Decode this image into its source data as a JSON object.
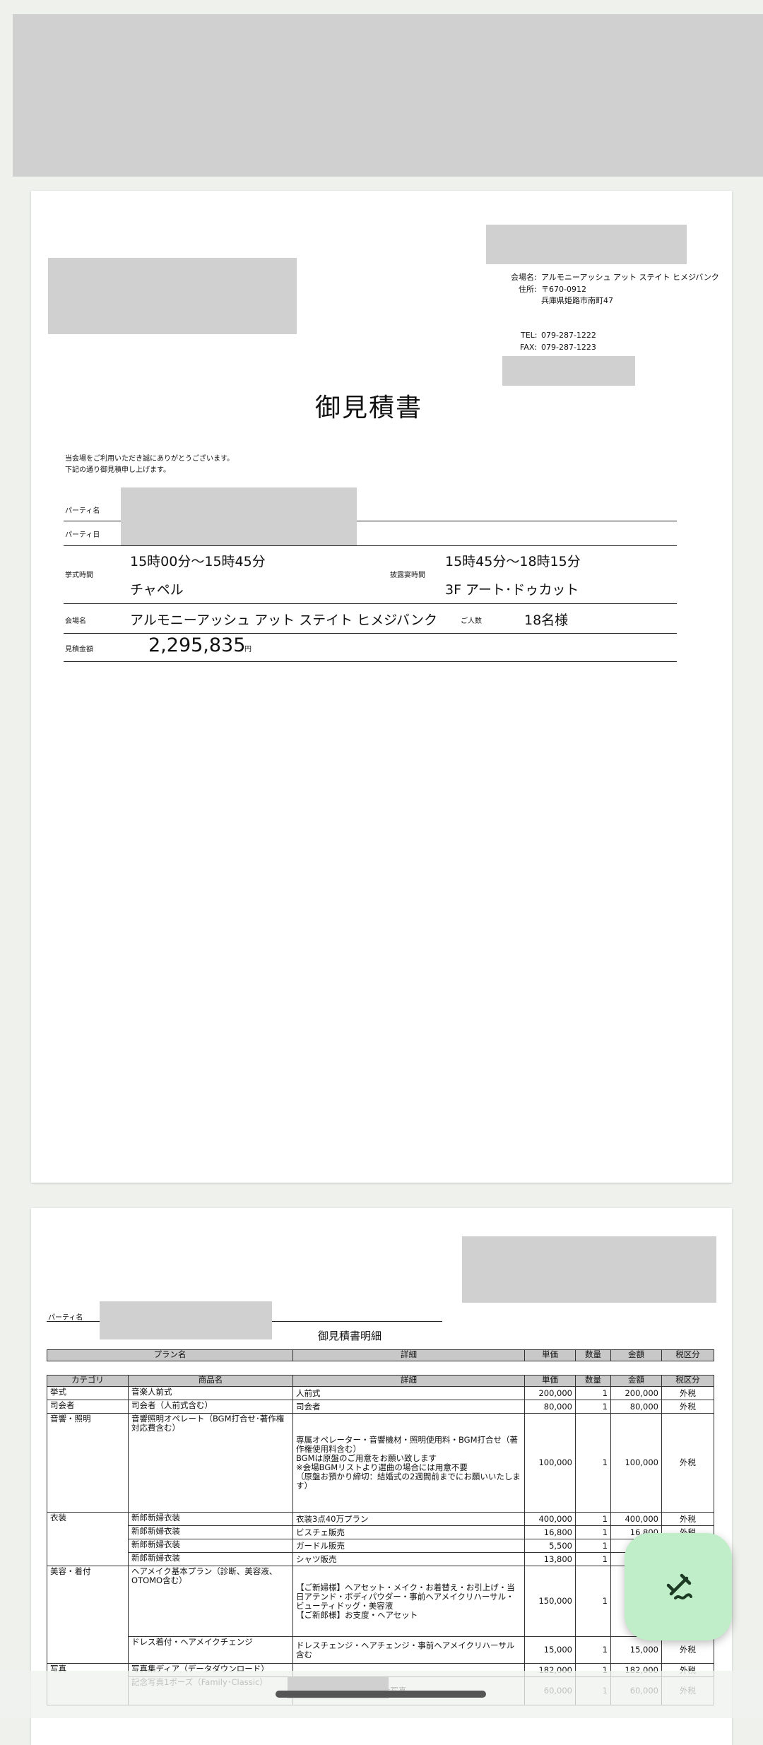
{
  "page1": {
    "venue_label": "会場名:",
    "venue_value": "アルモニーアッシュ アット ステイト ヒメジバンク",
    "address_label": "住所:",
    "postal": "〒670-0912",
    "address": "兵庫県姫路市南町47",
    "tel_label": "TEL:",
    "tel": "079-287-1222",
    "fax_label": "FAX:",
    "fax": "079-287-1223",
    "title": "御見積書",
    "greeting_line1": "当会場をご利用いただき誠にありがとうございます。",
    "greeting_line2": "下記の通り御見積申し上げます。",
    "party_name_label": "パーティ名",
    "party_date_label": "パーティ日",
    "ceremony_time_label": "挙式時間",
    "ceremony_time": "15時00分～15時45分",
    "ceremony_place": "チャペル",
    "reception_time_label": "披露宴時間",
    "reception_time": "15時45分～18時15分",
    "reception_place": "3F アート･ドゥカット",
    "hall_label": "会場名",
    "hall_value": "アルモニーアッシュ アット ステイト ヒメジバンク",
    "guests_label": "ご人数",
    "guests_value": "18名様",
    "estimate_label": "見積金額",
    "estimate_amount": "2,295,835",
    "estimate_unit": "円"
  },
  "page2": {
    "party_name_label": "パーティ名",
    "title": "御見積書明細",
    "plan_headers": [
      "プラン名",
      "詳細",
      "単価",
      "数量",
      "金額",
      "税区分"
    ],
    "item_headers": [
      "カテゴリ",
      "商品名",
      "詳細",
      "単価",
      "数量",
      "金額",
      "税区分"
    ],
    "rows": [
      {
        "cat": "挙式",
        "name": "音楽人前式",
        "detail": "人前式",
        "price": "200,000",
        "qty": "1",
        "amount": "200,000",
        "tax": "外税"
      },
      {
        "cat": "司会者",
        "name": "司会者（人前式含む）",
        "detail": "司会者",
        "price": "80,000",
        "qty": "1",
        "amount": "80,000",
        "tax": "外税"
      },
      {
        "cat": "音響・照明",
        "name": "音響照明オペレート（BGM打合せ･著作権対応費含む）",
        "detail": "専属オペレーター・音響機材・照明使用料・BGM打合せ（著作権使用料含む）\nBGMは原盤のご用意をお願い致します\n※会場BGMリストより選曲の場合には用意不要\n（原盤お預かり締切：結婚式の2週間前までにお願いいたします）",
        "price": "100,000",
        "qty": "1",
        "amount": "100,000",
        "tax": "外税"
      },
      {
        "cat": "衣装",
        "name": "新郎新婦衣装",
        "detail": "衣装3点40万プラン",
        "price": "400,000",
        "qty": "1",
        "amount": "400,000",
        "tax": "外税"
      },
      {
        "cat": "",
        "name": "新郎新婦衣装",
        "detail": "ビスチェ販売",
        "price": "16,800",
        "qty": "1",
        "amount": "16,800",
        "tax": "外税"
      },
      {
        "cat": "",
        "name": "新郎新婦衣装",
        "detail": "ガードル販売",
        "price": "5,500",
        "qty": "1",
        "amount": "5,500",
        "tax": "外税"
      },
      {
        "cat": "",
        "name": "新郎新婦衣装",
        "detail": "シャツ販売",
        "price": "13,800",
        "qty": "1",
        "amount": "13,800",
        "tax": "外税"
      },
      {
        "cat": "美容・着付",
        "name": "ヘアメイク基本プラン（診断、美容液、OTOMO含む）",
        "detail": "【ご新婦様】ヘアセット・メイク・お着替え・お引上げ・当日アテンド・ボディパウダー・事前ヘアメイクリハーサル・ビューティドッグ・美容液\n【ご新郎様】お支度・ヘアセット",
        "price": "150,000",
        "qty": "1",
        "amount": "150,000",
        "tax": "外税"
      },
      {
        "cat": "",
        "name": "ドレス着付・ヘアメイクチェンジ",
        "detail": "ドレスチェンジ・ヘアチェンジ・事前ヘアメイクリハーサル含む",
        "price": "15,000",
        "qty": "1",
        "amount": "15,000",
        "tax": "外税"
      },
      {
        "cat": "写真",
        "name": "写真集ディア（データダウンロード）",
        "detail": "",
        "price": "182,000",
        "qty": "1",
        "amount": "182,000",
        "tax": "外税"
      },
      {
        "cat": "",
        "name": "記念写真1ポーズ（Family･Classic）",
        "detail": "1ポーズ、台紙、親族集合写真",
        "price": "60,000",
        "qty": "1",
        "amount": "60,000",
        "tax": "外税"
      }
    ]
  }
}
